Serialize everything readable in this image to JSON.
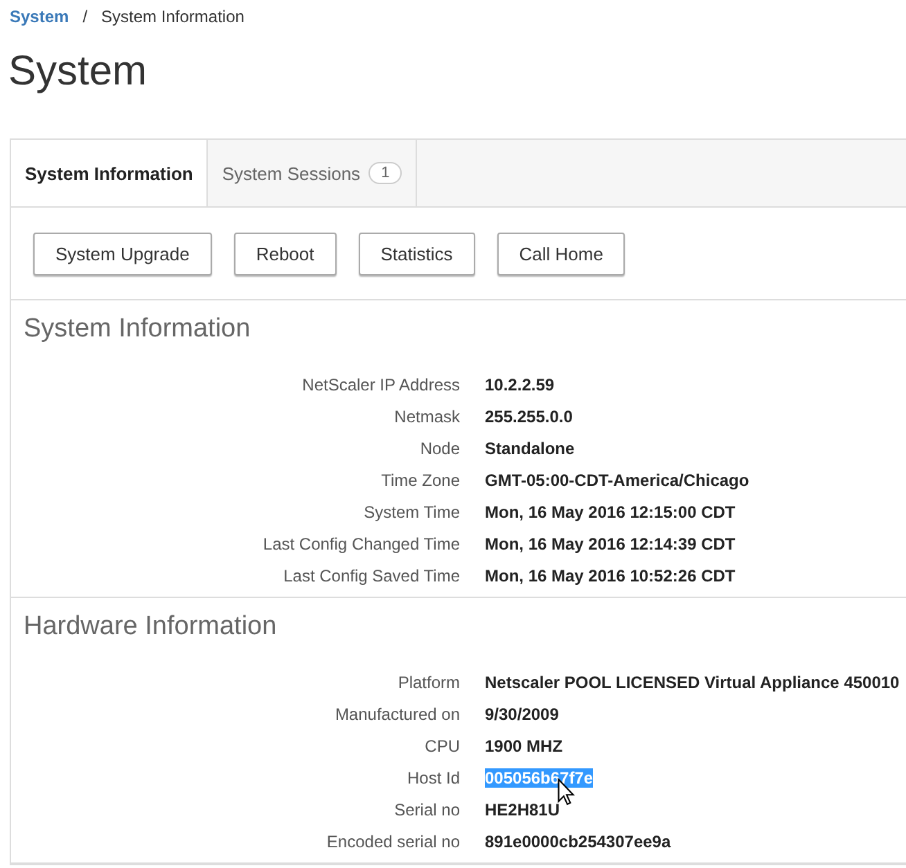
{
  "breadcrumb": {
    "link": "System",
    "separator": "/",
    "current": "System Information"
  },
  "page_title": "System",
  "tabs": [
    {
      "label": "System Information",
      "selected": true
    },
    {
      "label": "System Sessions",
      "badge": "1",
      "selected": false
    }
  ],
  "buttons": [
    "System Upgrade",
    "Reboot",
    "Statistics",
    "Call Home"
  ],
  "sections": [
    {
      "title": "System Information",
      "rows": [
        {
          "label": "NetScaler IP Address",
          "value": "10.2.2.59",
          "highlighted": false
        },
        {
          "label": "Netmask",
          "value": "255.255.0.0",
          "highlighted": false
        },
        {
          "label": "Node",
          "value": "Standalone",
          "highlighted": false
        },
        {
          "label": "Time Zone",
          "value": "GMT-05:00-CDT-America/Chicago",
          "highlighted": false
        },
        {
          "label": "System Time",
          "value": "Mon, 16 May 2016 12:15:00 CDT",
          "highlighted": false
        },
        {
          "label": "Last Config Changed Time",
          "value": "Mon, 16 May 2016 12:14:39 CDT",
          "highlighted": false
        },
        {
          "label": "Last Config Saved Time",
          "value": "Mon, 16 May 2016 10:52:26 CDT",
          "highlighted": false
        }
      ]
    },
    {
      "title": "Hardware Information",
      "rows": [
        {
          "label": "Platform",
          "value": "Netscaler POOL LICENSED Virtual Appliance 450010",
          "highlighted": false
        },
        {
          "label": "Manufactured on",
          "value": "9/30/2009",
          "highlighted": false
        },
        {
          "label": "CPU",
          "value": "1900 MHZ",
          "highlighted": false
        },
        {
          "label": "Host Id",
          "value": "005056b67f7e",
          "highlighted": true
        },
        {
          "label": "Serial no",
          "value": "HE2H81U",
          "highlighted": false
        },
        {
          "label": "Encoded serial no",
          "value": "891e0000cb254307ee9a",
          "highlighted": false
        }
      ]
    }
  ]
}
